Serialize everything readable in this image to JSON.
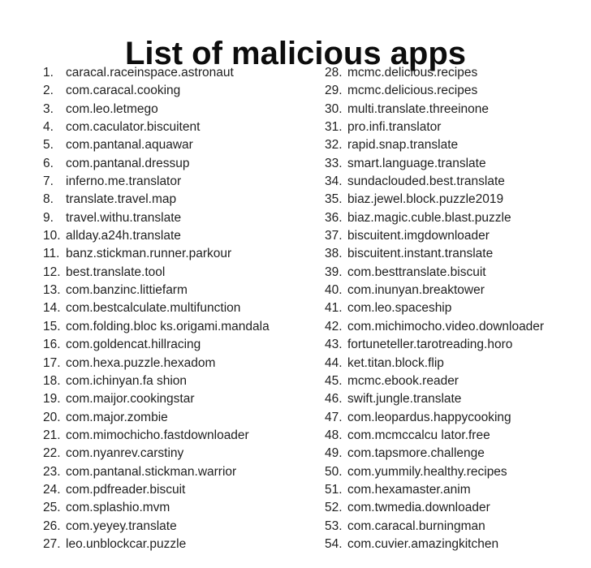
{
  "title": "List of malicious apps",
  "left_column": [
    {
      "number": "1.",
      "name": "caracal.raceinspace.astronaut"
    },
    {
      "number": "2.",
      "name": "com.caracal.cooking"
    },
    {
      "number": "3.",
      "name": "com.leo.letmego"
    },
    {
      "number": "4.",
      "name": "com.caculator.biscuitent"
    },
    {
      "number": "5.",
      "name": "com.pantanal.aquawar"
    },
    {
      "number": "6.",
      "name": "com.pantanal.dressup"
    },
    {
      "number": "7.",
      "name": "inferno.me.translator"
    },
    {
      "number": "8.",
      "name": "translate.travel.map"
    },
    {
      "number": "9.",
      "name": "travel.withu.translate"
    },
    {
      "number": "10.",
      "name": "allday.a24h.translate"
    },
    {
      "number": "11.",
      "name": "banz.stickman.runner.parkour"
    },
    {
      "number": "12.",
      "name": "best.translate.tool"
    },
    {
      "number": "13.",
      "name": "com.banzinc.littiefarm"
    },
    {
      "number": "14.",
      "name": "com.bestcalculate.multifunction"
    },
    {
      "number": "15.",
      "name": "com.folding.bloc ks.origami.mandala"
    },
    {
      "number": "16.",
      "name": "com.goldencat.hillracing"
    },
    {
      "number": "17.",
      "name": "com.hexa.puzzle.hexadom"
    },
    {
      "number": "18.",
      "name": "com.ichinyan.fa shion"
    },
    {
      "number": "19.",
      "name": "com.maijor.cookingstar"
    },
    {
      "number": "20.",
      "name": "com.major.zombie"
    },
    {
      "number": "21.",
      "name": "com.mimochicho.fastdownloader"
    },
    {
      "number": "22.",
      "name": "com.nyanrev.carstiny"
    },
    {
      "number": "23.",
      "name": "com.pantanal.stickman.warrior"
    },
    {
      "number": "24.",
      "name": "com.pdfreader.biscuit"
    },
    {
      "number": "25.",
      "name": "com.splashio.mvm"
    },
    {
      "number": "26.",
      "name": "com.yeyey.translate"
    },
    {
      "number": "27.",
      "name": "leo.unblockcar.puzzle"
    }
  ],
  "right_column": [
    {
      "number": "28.",
      "name": "mcmc.delicious.recipes"
    },
    {
      "number": "29.",
      "name": "mcmc.delicious.recipes"
    },
    {
      "number": "30.",
      "name": "multi.translate.threeinone"
    },
    {
      "number": "31.",
      "name": "pro.infi.translator"
    },
    {
      "number": "32.",
      "name": "rapid.snap.translate"
    },
    {
      "number": "33.",
      "name": "smart.language.translate"
    },
    {
      "number": "34.",
      "name": "sundaclouded.best.translate"
    },
    {
      "number": "35.",
      "name": "biaz.jewel.block.puzzle2019"
    },
    {
      "number": "36.",
      "name": "biaz.magic.cuble.blast.puzzle"
    },
    {
      "number": "37.",
      "name": "biscuitent.imgdownloader"
    },
    {
      "number": "38.",
      "name": "biscuitent.instant.translate"
    },
    {
      "number": "39.",
      "name": "com.besttranslate.biscuit"
    },
    {
      "number": "40.",
      "name": "com.inunyan.breaktower"
    },
    {
      "number": "41.",
      "name": "com.leo.spaceship"
    },
    {
      "number": "42.",
      "name": "com.michimocho.video.downloader"
    },
    {
      "number": "43.",
      "name": "fortuneteller.tarotreading.horo"
    },
    {
      "number": "44.",
      "name": "ket.titan.block.flip"
    },
    {
      "number": "45.",
      "name": "mcmc.ebook.reader"
    },
    {
      "number": "46.",
      "name": "swift.jungle.translate"
    },
    {
      "number": "47.",
      "name": "com.leopardus.happycooking"
    },
    {
      "number": "48.",
      "name": "com.mcmccalcu lator.free"
    },
    {
      "number": "49.",
      "name": "com.tapsmore.challenge"
    },
    {
      "number": "50.",
      "name": "com.yummily.healthy.recipes"
    },
    {
      "number": "51.",
      "name": "com.hexamaster.anim"
    },
    {
      "number": "52.",
      "name": "com.twmedia.downloader"
    },
    {
      "number": "53.",
      "name": "com.caracal.burningman"
    },
    {
      "number": "54.",
      "name": "com.cuvier.amazingkitchen"
    }
  ]
}
